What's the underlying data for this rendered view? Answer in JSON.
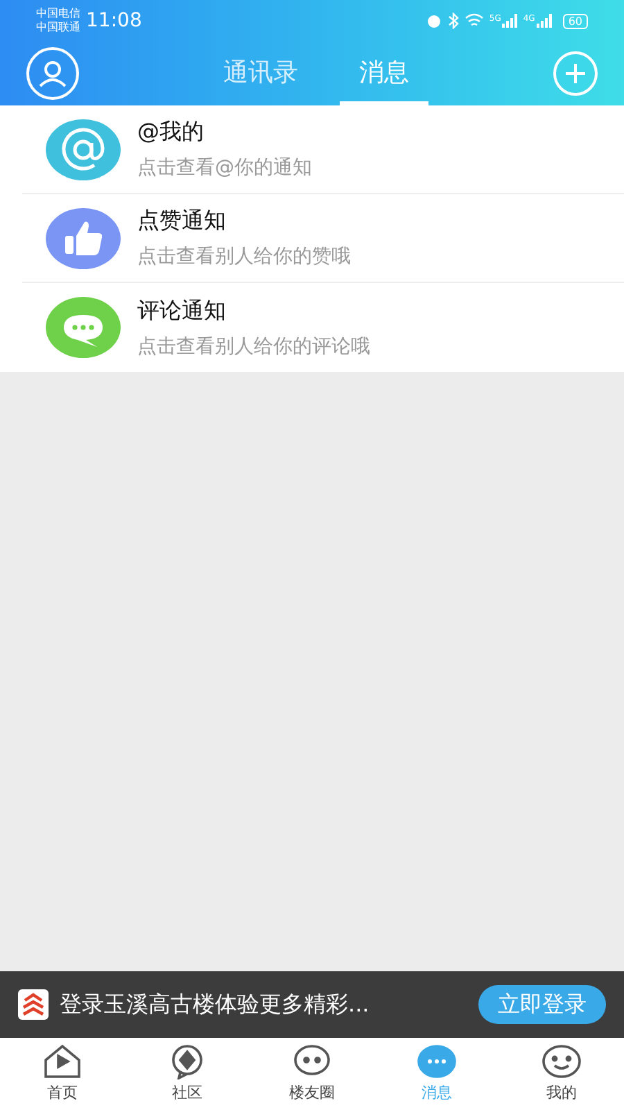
{
  "status_bar": {
    "carriers": [
      "中国电信",
      "中国联通"
    ],
    "time": "11:08",
    "signals": [
      "5G",
      "4G"
    ],
    "battery": "60"
  },
  "header": {
    "tabs": [
      {
        "label": "通讯录",
        "selected": false
      },
      {
        "label": "消息",
        "selected": true
      }
    ]
  },
  "notifications": [
    {
      "kind": "mention",
      "title": "@我的",
      "subtitle": "点击查看@你的通知",
      "color": "#3fc0dc"
    },
    {
      "kind": "like",
      "title": "点赞通知",
      "subtitle": "点击查看别人给你的赞哦",
      "color": "#7b95f5"
    },
    {
      "kind": "comment",
      "title": "评论通知",
      "subtitle": "点击查看别人给你的评论哦",
      "color": "#6fd04a"
    }
  ],
  "login_banner": {
    "text": "登录玉溪高古楼体验更多精彩...",
    "button": "立即登录"
  },
  "bottom_nav": [
    {
      "kind": "home",
      "label": "首页",
      "selected": false
    },
    {
      "kind": "community",
      "label": "社区",
      "selected": false
    },
    {
      "kind": "circle",
      "label": "楼友圈",
      "selected": false
    },
    {
      "kind": "message",
      "label": "消息",
      "selected": true
    },
    {
      "kind": "mine",
      "label": "我的",
      "selected": false
    }
  ]
}
